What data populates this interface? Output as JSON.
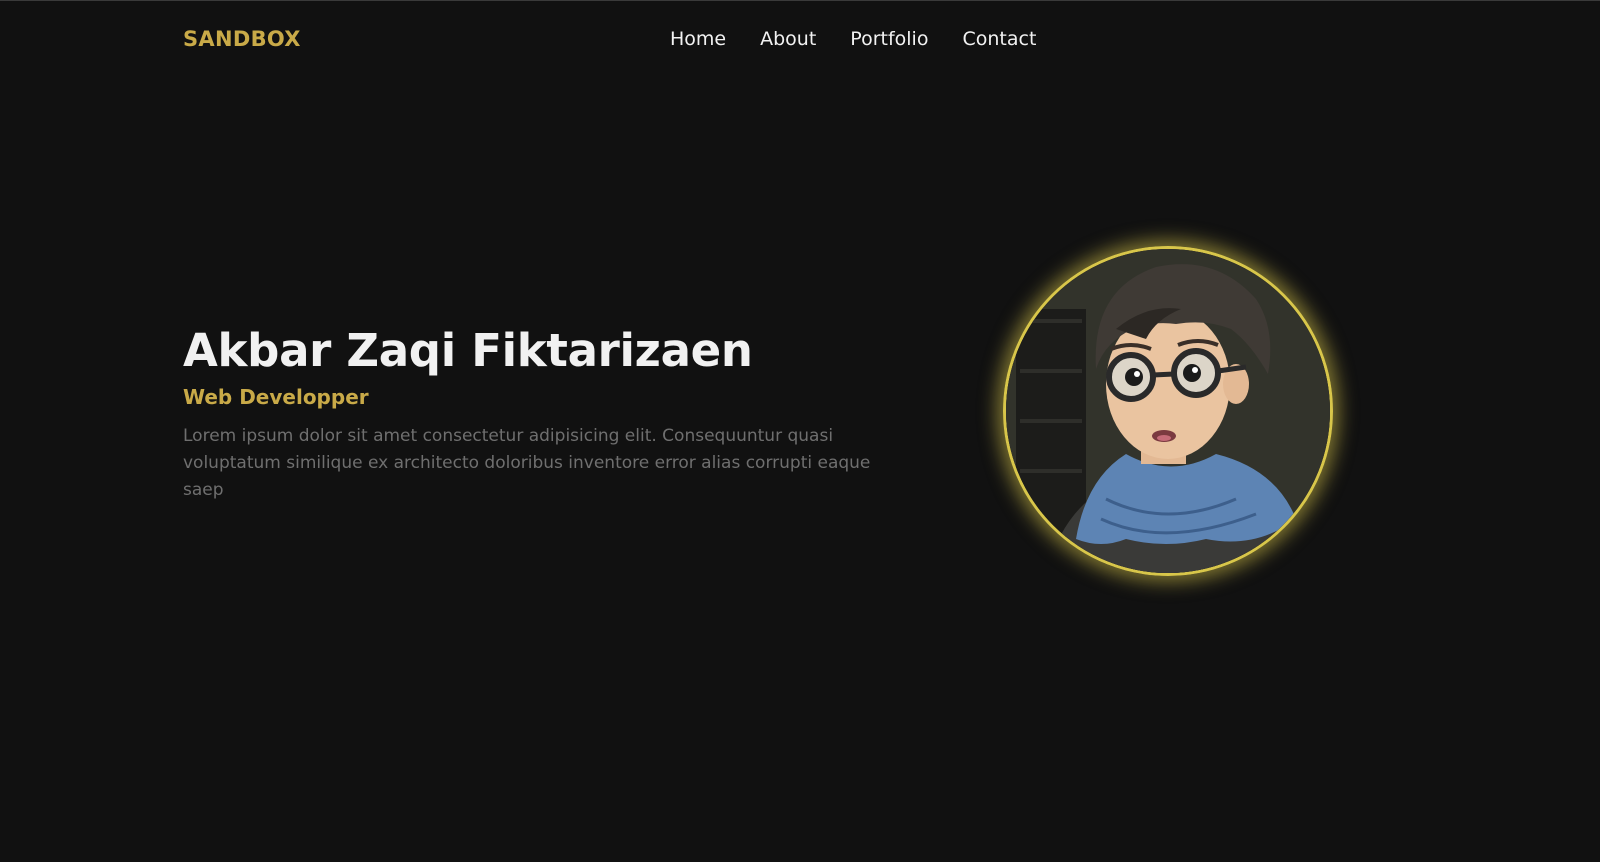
{
  "nav": {
    "brand": "SANDBOX",
    "links": [
      {
        "label": "Home"
      },
      {
        "label": "About"
      },
      {
        "label": "Portfolio"
      },
      {
        "label": "Contact"
      }
    ]
  },
  "hero": {
    "name": "Akbar Zaqi Fiktarizaen",
    "role": "Web Developper",
    "description": "Lorem ipsum dolor sit amet consectetur adipisicing elit. Consequuntur quasi voluptatum similique ex architecto doloribus inventore error alias corrupti eaque saep"
  },
  "colors": {
    "background": "#111111",
    "accent": "#c9aa48",
    "heading": "#f1f1f1",
    "muted_text": "#6f6f6f",
    "avatar_ring": "#d8c64a"
  }
}
